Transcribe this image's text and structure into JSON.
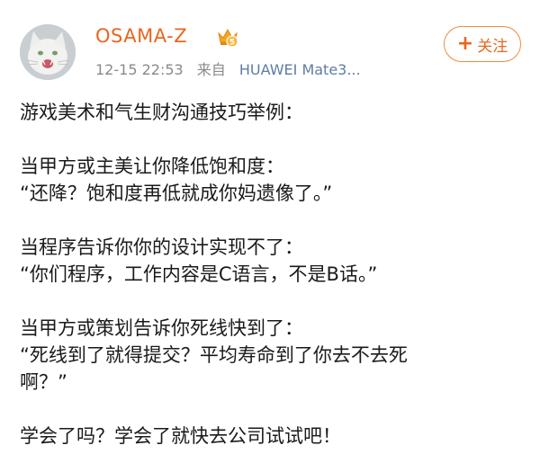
{
  "user": {
    "name": "OSAMA-Z",
    "time": "12-15  22:53",
    "from_label": "来自",
    "device": "HUAWEI Mate3...",
    "crown_icon": "crown-badge-icon"
  },
  "follow_button": {
    "plus": "+",
    "label": "关注"
  },
  "post": {
    "title": "游戏美术和气生财沟通技巧举例：",
    "case1_setup": "当甲方或主美让你降低饱和度：",
    "case1_reply": "“还降？饱和度再低就成你妈遗像了。”",
    "case2_setup": "当程序告诉你你的设计实现不了：",
    "case2_reply": "“你们程序，工作内容是C语言，不是B话。”",
    "case3_setup": "当甲方或策划告诉你死线快到了：",
    "case3_reply_line1": "“死线到了就得提交？平均寿命到了你去不去死",
    "case3_reply_line2": "啊？”",
    "closing": "学会了吗？学会了就快去公司试试吧！"
  },
  "colors": {
    "username": "#e8661f",
    "follow_border": "#ef8a3c",
    "meta": "#8a8a8a",
    "device": "#5d7da6"
  }
}
